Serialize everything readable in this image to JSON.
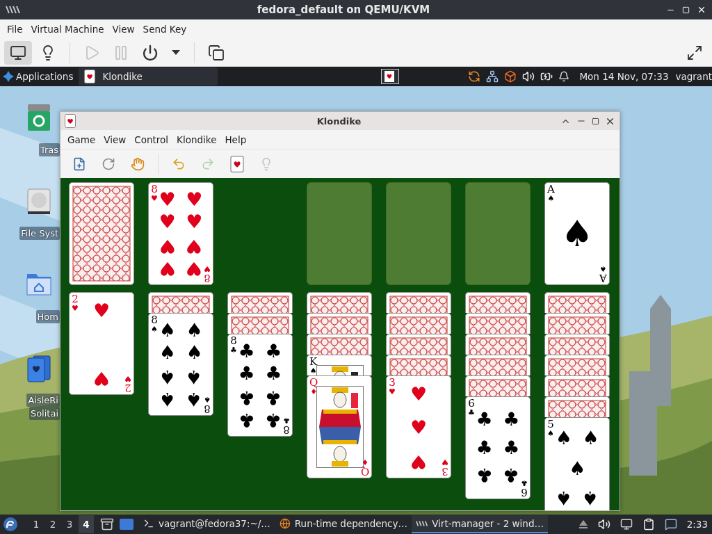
{
  "vm_window": {
    "title": "fedora_default on QEMU/KVM"
  },
  "vm_menu": [
    "File",
    "Virtual Machine",
    "View",
    "Send Key"
  ],
  "vm_toolbar": [
    {
      "kind": "console",
      "selected": true,
      "disabled": false
    },
    {
      "kind": "details",
      "disabled": false
    },
    {
      "kind": "separator"
    },
    {
      "kind": "run",
      "disabled": true
    },
    {
      "kind": "pause",
      "disabled": true
    },
    {
      "kind": "power",
      "disabled": false
    },
    {
      "kind": "power-menu",
      "disabled": false
    },
    {
      "kind": "separator"
    },
    {
      "kind": "screens",
      "disabled": false
    },
    {
      "kind": "fullscreen",
      "disabled": false
    }
  ],
  "guest_panel": {
    "apps_label": "Applications",
    "task": {
      "label": "Klondike"
    },
    "clock": "Mon 14 Nov, 07:33",
    "user": "vagrant"
  },
  "desktop_icons": [
    {
      "kind": "trash",
      "label": [
        "Tras"
      ]
    },
    {
      "kind": "drive",
      "label": [
        "File Syst"
      ]
    },
    {
      "kind": "home",
      "label": [
        "Hom"
      ]
    },
    {
      "kind": "cards",
      "label": [
        "AisleRi",
        "Solitai"
      ]
    }
  ],
  "klondike": {
    "title": "Klondike",
    "menu": [
      "Game",
      "View",
      "Control",
      "Klondike",
      "Help"
    ],
    "toolbar": [
      {
        "kind": "new",
        "disabled": false
      },
      {
        "kind": "restart",
        "disabled": false
      },
      {
        "kind": "select",
        "disabled": false
      },
      {
        "kind": "separator"
      },
      {
        "kind": "undo",
        "disabled": false
      },
      {
        "kind": "redo",
        "disabled": true
      },
      {
        "kind": "deal",
        "disabled": false
      },
      {
        "kind": "hint",
        "disabled": true
      }
    ],
    "top_row": [
      {
        "kind": "stock",
        "cards": [
          {
            "kind": "back"
          }
        ]
      },
      {
        "kind": "waste",
        "cards": [
          {
            "kind": "pips",
            "color": "#e0001b",
            "corners": [
              {
                "rank": "8",
                "suit": "♥"
              },
              {
                "rank": "8",
                "suit": "♥"
              }
            ],
            "pips": [
              "♥",
              "♥",
              "♥",
              "♥",
              "♥",
              "♥",
              "♥",
              "♥"
            ]
          }
        ]
      },
      {
        "kind": "gap"
      },
      {
        "kind": "foundation"
      },
      {
        "kind": "foundation"
      },
      {
        "kind": "foundation"
      },
      {
        "kind": "foundation",
        "cards": [
          {
            "kind": "pips",
            "color": "#000000",
            "corners": [
              {
                "rank": "A",
                "suit": "♠"
              },
              {
                "rank": "A",
                "suit": "♠"
              }
            ],
            "pips": [
              "♠"
            ]
          }
        ]
      }
    ],
    "tableau": [
      {
        "cards": [
          {
            "kind": "pips",
            "color": "#e0001b",
            "corners": [
              {
                "rank": "2",
                "suit": "♥"
              },
              {
                "rank": "2",
                "suit": "♥"
              }
            ],
            "pips": [
              "♥",
              "♥"
            ]
          }
        ]
      },
      {
        "cards": [
          {
            "kind": "back"
          },
          {
            "kind": "pips",
            "color": "#000000",
            "corners": [
              {
                "rank": "8",
                "suit": "♠"
              },
              {
                "rank": "8",
                "suit": "♠"
              }
            ],
            "pips": [
              "♠",
              "♠",
              "♠",
              "♠",
              "♠",
              "♠",
              "♠",
              "♠"
            ]
          }
        ]
      },
      {
        "cards": [
          {
            "kind": "back"
          },
          {
            "kind": "back"
          },
          {
            "kind": "pips",
            "color": "#000000",
            "corners": [
              {
                "rank": "8",
                "suit": "♣"
              },
              {
                "rank": "8",
                "suit": "♣"
              }
            ],
            "pips": [
              "♣",
              "♣",
              "♣",
              "♣",
              "♣",
              "♣",
              "♣",
              "♣"
            ]
          }
        ]
      },
      {
        "cards": [
          {
            "kind": "back"
          },
          {
            "kind": "back"
          },
          {
            "kind": "back"
          },
          {
            "kind": "face",
            "color": "#000000",
            "corners": [
              {
                "rank": "K",
                "suit": "♠"
              }
            ]
          },
          {
            "kind": "face",
            "color": "#e0001b",
            "corners": [
              {
                "rank": "Q",
                "suit": "♦"
              },
              {
                "rank": "Q",
                "suit": "♦"
              }
            ]
          }
        ]
      },
      {
        "cards": [
          {
            "kind": "back"
          },
          {
            "kind": "back"
          },
          {
            "kind": "back"
          },
          {
            "kind": "back"
          },
          {
            "kind": "pips",
            "color": "#e0001b",
            "corners": [
              {
                "rank": "3",
                "suit": "♥"
              },
              {
                "rank": "3",
                "suit": "♥"
              }
            ],
            "pips": [
              "♥",
              "♥",
              "♥"
            ]
          }
        ]
      },
      {
        "cards": [
          {
            "kind": "back"
          },
          {
            "kind": "back"
          },
          {
            "kind": "back"
          },
          {
            "kind": "back"
          },
          {
            "kind": "back"
          },
          {
            "kind": "pips",
            "color": "#000000",
            "corners": [
              {
                "rank": "6",
                "suit": "♣"
              },
              {
                "rank": "6",
                "suit": "♣"
              }
            ],
            "pips": [
              "♣",
              "♣",
              "♣",
              "♣",
              "♣",
              "♣"
            ]
          }
        ]
      },
      {
        "cards": [
          {
            "kind": "back"
          },
          {
            "kind": "back"
          },
          {
            "kind": "back"
          },
          {
            "kind": "back"
          },
          {
            "kind": "back"
          },
          {
            "kind": "back"
          },
          {
            "kind": "pips",
            "color": "#000000",
            "corners": [
              {
                "rank": "5",
                "suit": "♠"
              }
            ],
            "pips": [
              "♠",
              "♠",
              "♠",
              "♠",
              "♠"
            ]
          }
        ]
      }
    ]
  },
  "taskbar": {
    "workspaces": [
      {
        "label": "1",
        "selected": false
      },
      {
        "label": "2",
        "selected": false
      },
      {
        "label": "3",
        "selected": false
      },
      {
        "label": "4",
        "selected": true
      }
    ],
    "tasks": [
      {
        "kind": "terminal",
        "label": "vagrant@fedora37:~/…",
        "selected": false
      },
      {
        "kind": "browser",
        "label": "Run-time dependency…",
        "selected": false
      },
      {
        "kind": "virt",
        "label": "Virt-manager - 2 wind…",
        "selected": true
      }
    ],
    "clock": "2:33"
  }
}
